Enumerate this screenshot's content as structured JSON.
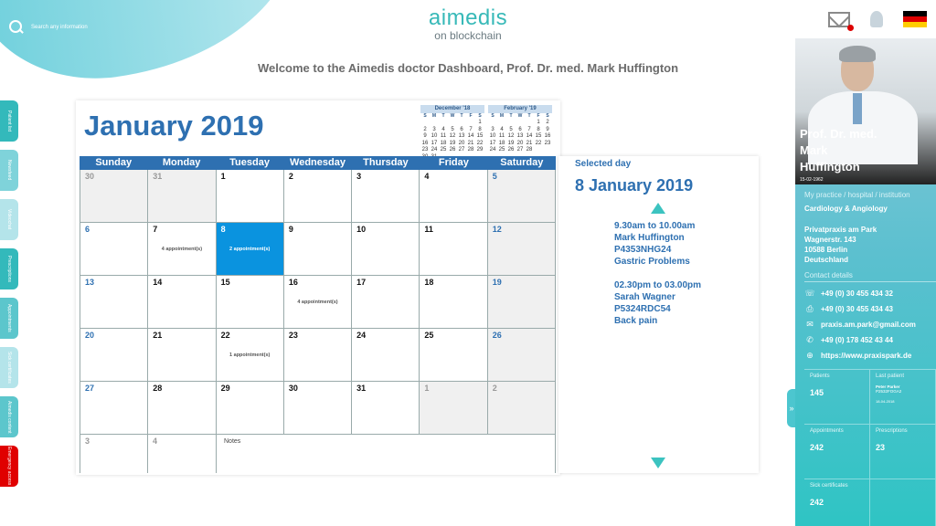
{
  "header": {
    "search_placeholder": "Search any information",
    "logo_main": "aimedis",
    "logo_sub": "on blockchain",
    "welcome": "Welcome to the Aimedis doctor Dashboard, Prof. Dr. med. Mark Huffington",
    "flag": "germany-flag"
  },
  "side_tabs": [
    {
      "label": "Patient list",
      "color": "#33b9bb"
    },
    {
      "label": "Newsfeed",
      "color": "#7fd3da"
    },
    {
      "label": "Videochat",
      "color": "#b4e4ea"
    },
    {
      "label": "Prescriptions",
      "color": "#33b9bb"
    },
    {
      "label": "Appointments",
      "color": "#5cc6cc"
    },
    {
      "label": "Sick certificates",
      "color": "#b4e4ea"
    },
    {
      "label": "Aimedis content",
      "color": "#5cc6cc"
    },
    {
      "label": "Emergency access",
      "color": "#e00000"
    }
  ],
  "calendar": {
    "title": "January 2019",
    "weekdays": [
      "Sunday",
      "Monday",
      "Tuesday",
      "Wednesday",
      "Thursday",
      "Friday",
      "Saturday"
    ],
    "mini_prev": {
      "title": "December '18",
      "days_head": [
        "S",
        "M",
        "T",
        "W",
        "T",
        "F",
        "S"
      ],
      "rows": [
        [
          "",
          "",
          "",
          "",
          "",
          "",
          "1"
        ],
        [
          "2",
          "3",
          "4",
          "5",
          "6",
          "7",
          "8"
        ],
        [
          "9",
          "10",
          "11",
          "12",
          "13",
          "14",
          "15"
        ],
        [
          "16",
          "17",
          "18",
          "19",
          "20",
          "21",
          "22"
        ],
        [
          "23",
          "24",
          "25",
          "26",
          "27",
          "28",
          "29"
        ],
        [
          "30",
          "31",
          "",
          "",
          "",
          "",
          ""
        ]
      ]
    },
    "mini_next": {
      "title": "February '19",
      "days_head": [
        "S",
        "M",
        "T",
        "W",
        "T",
        "F",
        "S"
      ],
      "rows": [
        [
          "",
          "",
          "",
          "",
          "",
          "1",
          "2"
        ],
        [
          "3",
          "4",
          "5",
          "6",
          "7",
          "8",
          "9"
        ],
        [
          "10",
          "11",
          "12",
          "13",
          "14",
          "15",
          "16"
        ],
        [
          "17",
          "18",
          "19",
          "20",
          "21",
          "22",
          "23"
        ],
        [
          "24",
          "25",
          "26",
          "27",
          "28",
          "",
          ""
        ]
      ]
    },
    "weeks": [
      [
        {
          "d": "30",
          "t": "faded"
        },
        {
          "d": "31",
          "t": "faded"
        },
        {
          "d": "1"
        },
        {
          "d": "2"
        },
        {
          "d": "3"
        },
        {
          "d": "4"
        },
        {
          "d": "5",
          "t": "sat"
        }
      ],
      [
        {
          "d": "6",
          "t": "sun"
        },
        {
          "d": "7",
          "ap": "4 appointment(s)"
        },
        {
          "d": "8",
          "ap": "2 appointment(s)",
          "t": "sel"
        },
        {
          "d": "9"
        },
        {
          "d": "10"
        },
        {
          "d": "11"
        },
        {
          "d": "12",
          "t": "sat"
        }
      ],
      [
        {
          "d": "13",
          "t": "sun"
        },
        {
          "d": "14"
        },
        {
          "d": "15"
        },
        {
          "d": "16",
          "ap": "4 appointment(s)"
        },
        {
          "d": "17"
        },
        {
          "d": "18"
        },
        {
          "d": "19",
          "t": "sat"
        }
      ],
      [
        {
          "d": "20",
          "t": "sun"
        },
        {
          "d": "21"
        },
        {
          "d": "22",
          "ap": "1 appointment(s)"
        },
        {
          "d": "23"
        },
        {
          "d": "24"
        },
        {
          "d": "25"
        },
        {
          "d": "26",
          "t": "sat"
        }
      ],
      [
        {
          "d": "27",
          "t": "sun"
        },
        {
          "d": "28"
        },
        {
          "d": "29"
        },
        {
          "d": "30"
        },
        {
          "d": "31"
        },
        {
          "d": "1",
          "t": "faded"
        },
        {
          "d": "2",
          "t": "faded"
        }
      ]
    ],
    "last_row": [
      "3",
      "4"
    ],
    "notes_label": "Notes"
  },
  "selected": {
    "label": "Selected day",
    "date": "8 January 2019",
    "appointments": [
      [
        "9.30am to 10.00am",
        "Mark Huffington",
        "P4353NHG24",
        "Gastric Problems"
      ],
      [
        "02.30pm to 03.00pm",
        "Sarah Wagner",
        "P5324RDC54",
        "Back pain"
      ]
    ]
  },
  "profile": {
    "name_lines": [
      "Prof. Dr. med.",
      "Mark",
      "Huffington"
    ],
    "dob": "15-02-1962",
    "practice_label": "My practice / hospital / institution",
    "specialty": "Cardiology & Angiology",
    "address": [
      "Privatpraxis am Park",
      "Wagnerstr. 143",
      "10588 Berlin",
      "Deutschland"
    ],
    "contact_label": "Contact details",
    "contacts": [
      {
        "icon": "phone-icon",
        "glyph": "☏",
        "text": "+49 (0) 30 455 434 32"
      },
      {
        "icon": "fax-icon",
        "glyph": "⎙",
        "text": "+49 (0) 30 455 434 43"
      },
      {
        "icon": "email-icon",
        "glyph": "✉",
        "text": "praxis.am.park@gmail.com"
      },
      {
        "icon": "mobile-icon",
        "glyph": "✆",
        "text": "+49 (0) 178 452 43 44"
      },
      {
        "icon": "web-icon",
        "glyph": "⊕",
        "text": "https://www.praxispark.de"
      }
    ],
    "stats": {
      "patients_label": "Patients",
      "patients": "145",
      "last_label": "Last patient",
      "last_name": "Peter Parker",
      "last_id": "P2532FOGA2",
      "last_date": "18-04-2018",
      "appointments_label": "Appointments",
      "appointments": "242",
      "prescriptions_label": "Prescriptions",
      "prescriptions": "23",
      "sick_label": "Sick certificates",
      "sick": "242"
    }
  }
}
